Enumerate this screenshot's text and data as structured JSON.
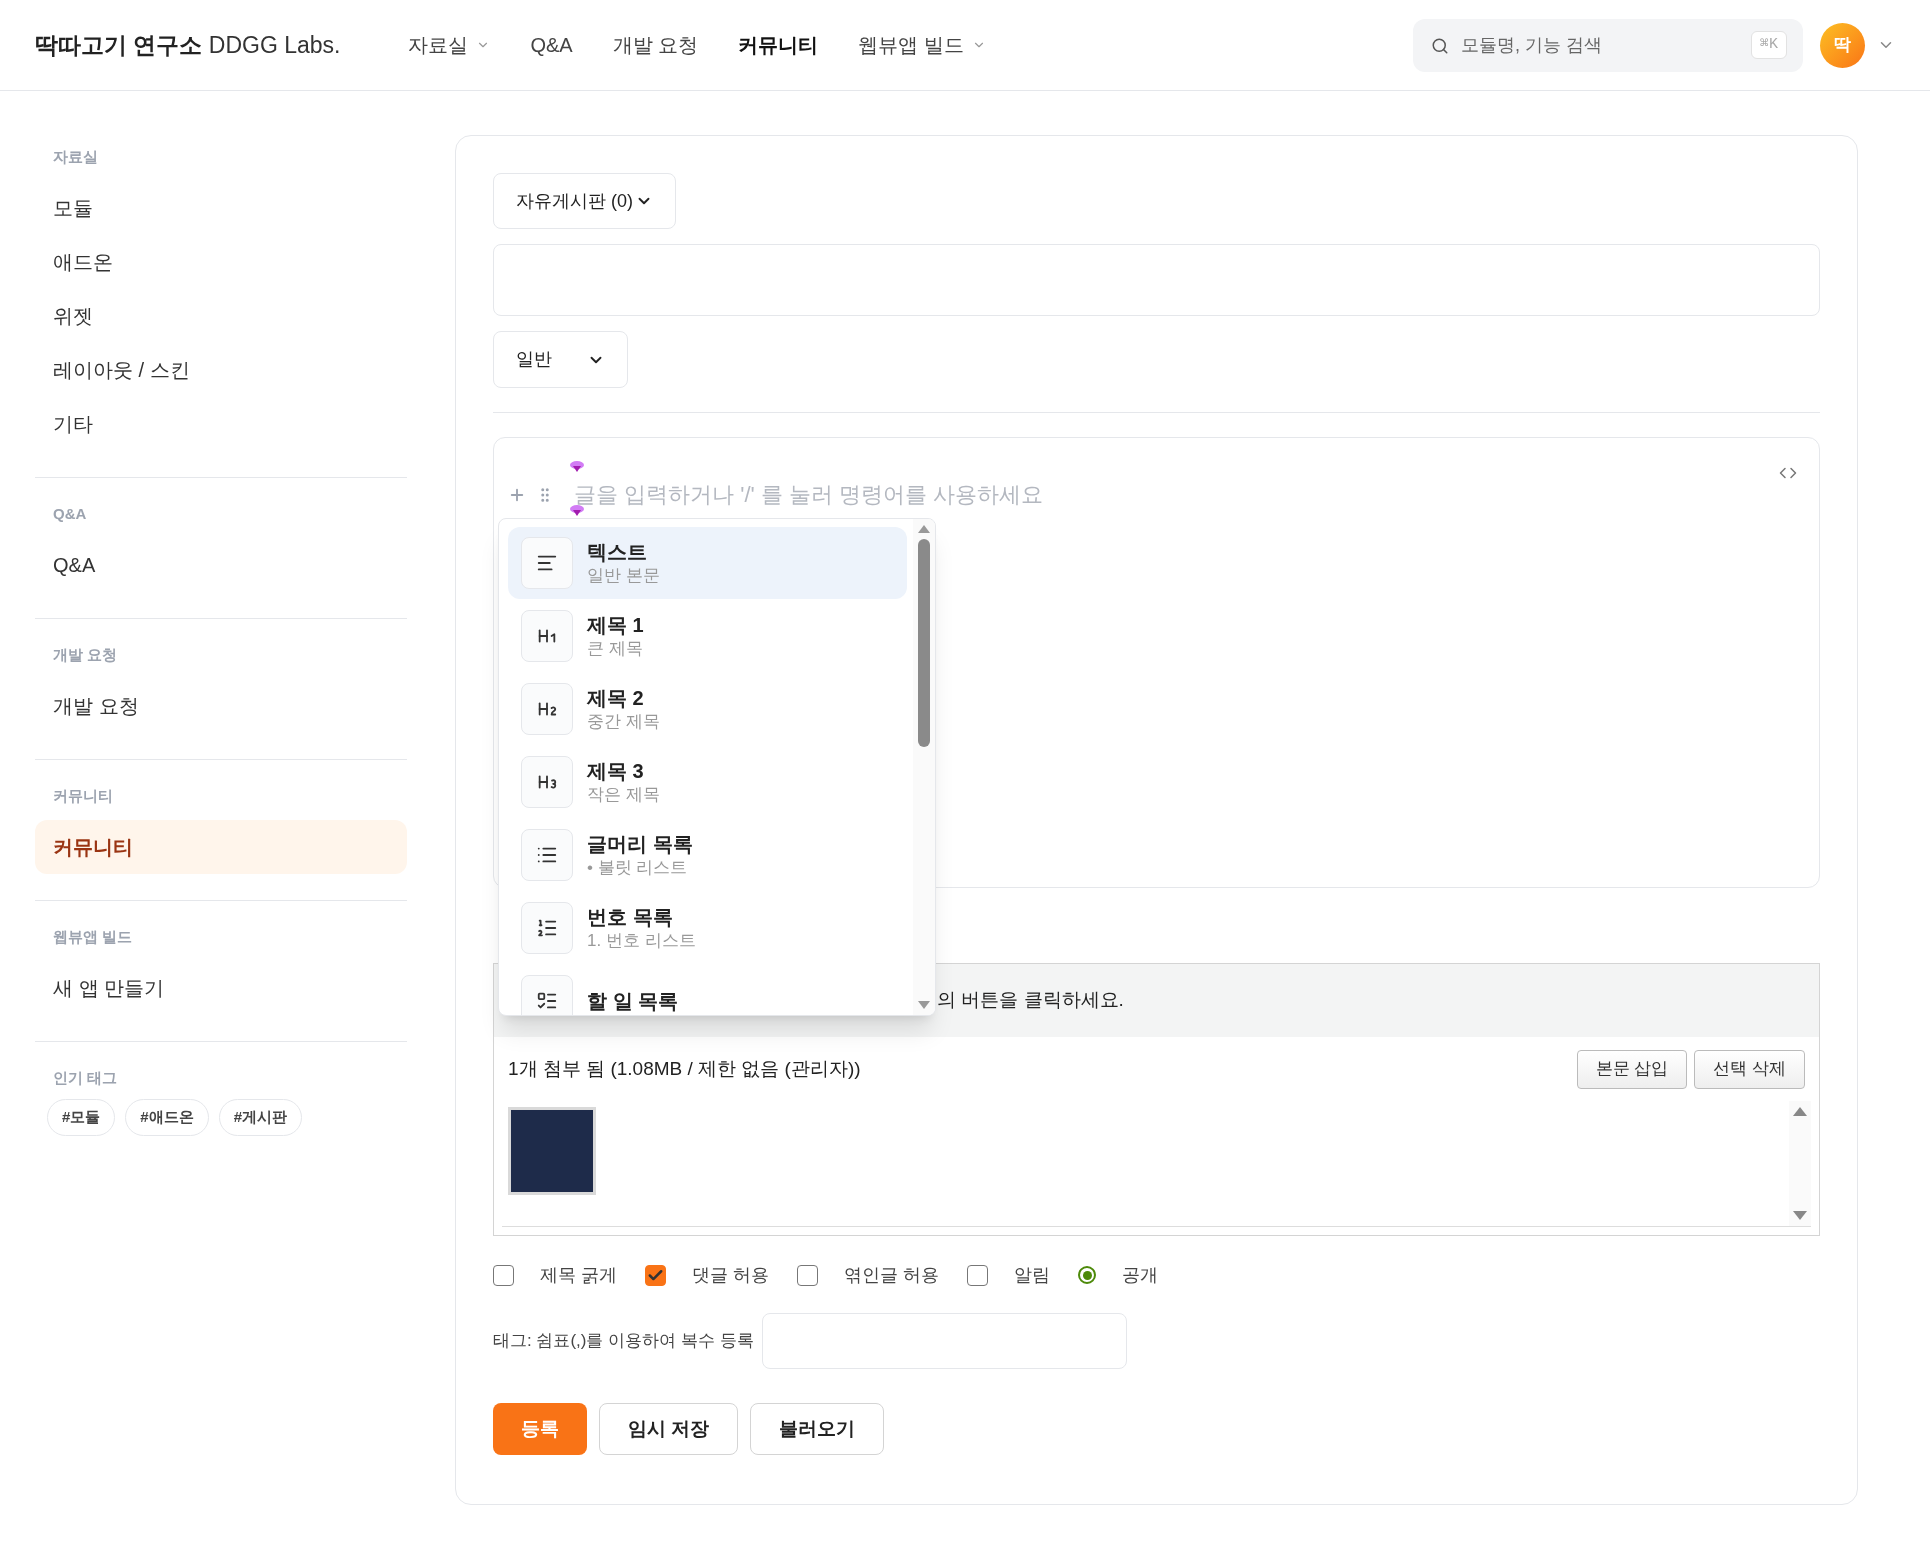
{
  "header": {
    "logo": {
      "brand": "딱따고기 연구소",
      "sub": "DDGG Labs."
    },
    "nav": [
      {
        "label": "자료실",
        "dropdown": true,
        "selected": false
      },
      {
        "label": "Q&A",
        "dropdown": false,
        "selected": false
      },
      {
        "label": "개발 요청",
        "dropdown": false,
        "selected": false
      },
      {
        "label": "커뮤니티",
        "dropdown": false,
        "selected": true
      },
      {
        "label": "웹뷰앱 빌드",
        "dropdown": true,
        "selected": false
      }
    ],
    "search": {
      "placeholder": "모듈명, 기능 검색",
      "shortcut": "⌘K"
    },
    "avatar": {
      "initial": "딱"
    }
  },
  "sidebar": {
    "sections": [
      {
        "heading": "자료실",
        "items": [
          {
            "label": "모듈",
            "selected": false
          },
          {
            "label": "애드온",
            "selected": false
          },
          {
            "label": "위젯",
            "selected": false
          },
          {
            "label": "레이아웃 / 스킨",
            "selected": false
          },
          {
            "label": "기타",
            "selected": false
          }
        ]
      },
      {
        "heading": "Q&A",
        "items": [
          {
            "label": "Q&A",
            "selected": false
          }
        ]
      },
      {
        "heading": "개발 요청",
        "items": [
          {
            "label": "개발 요청",
            "selected": false
          }
        ]
      },
      {
        "heading": "커뮤니티",
        "items": [
          {
            "label": "커뮤니티",
            "selected": true
          }
        ]
      },
      {
        "heading": "웹뷰앱 빌드",
        "items": [
          {
            "label": "새 앱 만들기",
            "selected": false
          }
        ]
      }
    ],
    "tags": {
      "heading": "인기 태그",
      "items": [
        "#모듈",
        "#애드온",
        "#게시판"
      ]
    }
  },
  "form": {
    "board_select": {
      "value": "자유게시판 (0)"
    },
    "category_select": {
      "value": "일반"
    },
    "editor": {
      "placeholder": "글을 입력하거나 '/' 를 눌러 명령어를 사용하세요"
    },
    "slash_menu": {
      "items": [
        {
          "kind": "text",
          "title": "텍스트",
          "subtitle": "일반 본문",
          "selected": true
        },
        {
          "kind": "h1",
          "title": "제목 1",
          "subtitle": "큰 제목",
          "selected": false
        },
        {
          "kind": "h2",
          "title": "제목 2",
          "subtitle": "중간 제목",
          "selected": false
        },
        {
          "kind": "h3",
          "title": "제목 3",
          "subtitle": "작은 제목",
          "selected": false
        },
        {
          "kind": "bullet",
          "title": "글머리 목록",
          "subtitle": "• 불릿 리스트",
          "selected": false
        },
        {
          "kind": "numbered",
          "title": "번호 목록",
          "subtitle": "1. 번호 리스트",
          "selected": false
        },
        {
          "kind": "todo",
          "title": "할 일 목록",
          "selected": false
        }
      ]
    },
    "attachments": {
      "hint": "의 버튼을 클릭하세요.",
      "summary": "1개 첨부 됨 (1.08MB / 제한 없음 (관리자))",
      "buttons": [
        "본문 삽입",
        "선택 삭제"
      ]
    },
    "options": [
      {
        "kind": "checkbox",
        "label": "제목 굵게",
        "checked": false
      },
      {
        "kind": "checkbox",
        "label": "댓글 허용",
        "checked": true
      },
      {
        "kind": "checkbox",
        "label": "엮인글 허용",
        "checked": false
      },
      {
        "kind": "checkbox",
        "label": "알림",
        "checked": false
      },
      {
        "kind": "radio",
        "label": "공개",
        "selected": true
      }
    ],
    "tags": {
      "label": "태그: 쉼표(,)를 이용하여 복수 등록"
    },
    "buttons": [
      {
        "label": "등록",
        "kind": "primary"
      },
      {
        "label": "임시 저장",
        "kind": "secondary"
      },
      {
        "label": "불러오기",
        "kind": "secondary"
      }
    ]
  }
}
